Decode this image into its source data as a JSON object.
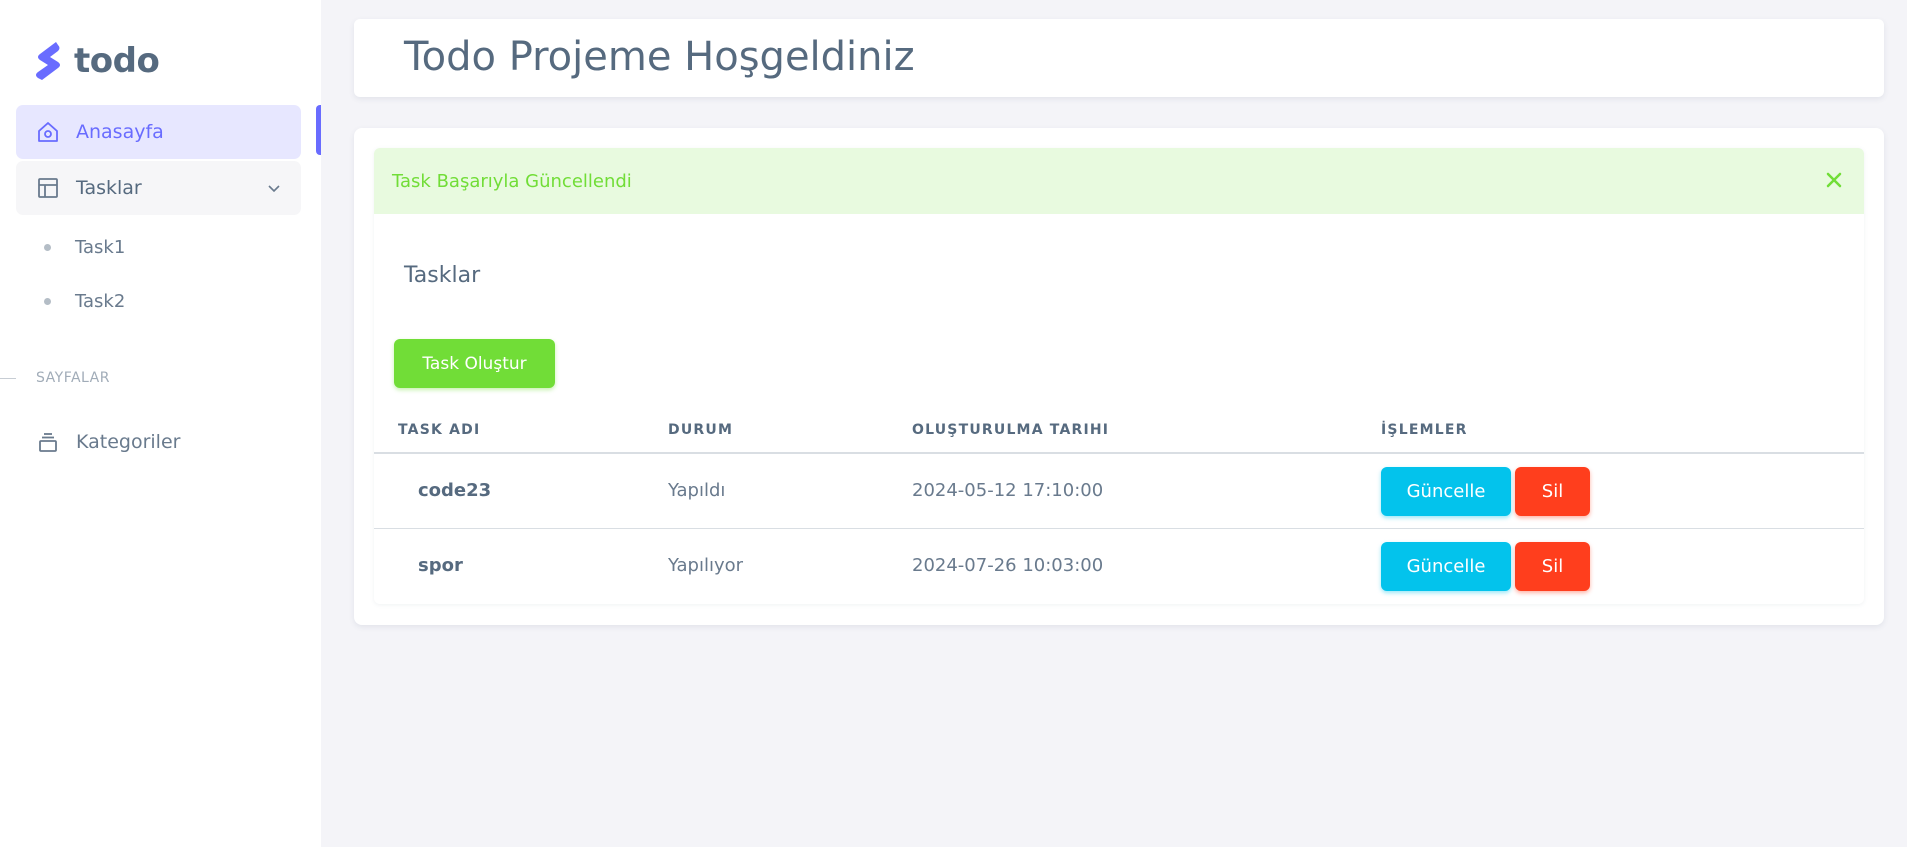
{
  "brand": {
    "name": "todo",
    "color": "#696cff"
  },
  "sidebar": {
    "items": [
      {
        "label": "Anasayfa",
        "icon": "home-icon",
        "active": true
      },
      {
        "label": "Tasklar",
        "icon": "layout-icon",
        "expanded": true,
        "children": [
          {
            "label": "Task1"
          },
          {
            "label": "Task2"
          }
        ]
      }
    ],
    "section_label": "SAYFALAR",
    "pages": [
      {
        "label": "Kategoriler",
        "icon": "stack-icon"
      }
    ]
  },
  "header": {
    "title": "Todo Projeme Hoşgeldiniz"
  },
  "alert": {
    "message": "Task Başarıyla Güncellendi",
    "close_icon": "close-icon",
    "color": "#71dd37"
  },
  "card": {
    "title": "Tasklar",
    "create_button": "Task Oluştur"
  },
  "table": {
    "columns": [
      "TASK ADI",
      "DURUM",
      "OLUŞTURULMA TARIHI",
      "İŞLEMLER"
    ],
    "rows": [
      {
        "name": "code23",
        "status": "Yapıldı",
        "created": "2024-05-12 17:10:00",
        "update": "Güncelle",
        "delete": "Sil"
      },
      {
        "name": "spor",
        "status": "Yapılıyor",
        "created": "2024-07-26 10:03:00",
        "update": "Güncelle",
        "delete": "Sil"
      }
    ]
  },
  "colors": {
    "primary": "#696cff",
    "success": "#71dd37",
    "info": "#03c3ec",
    "danger": "#ff3e1d"
  }
}
